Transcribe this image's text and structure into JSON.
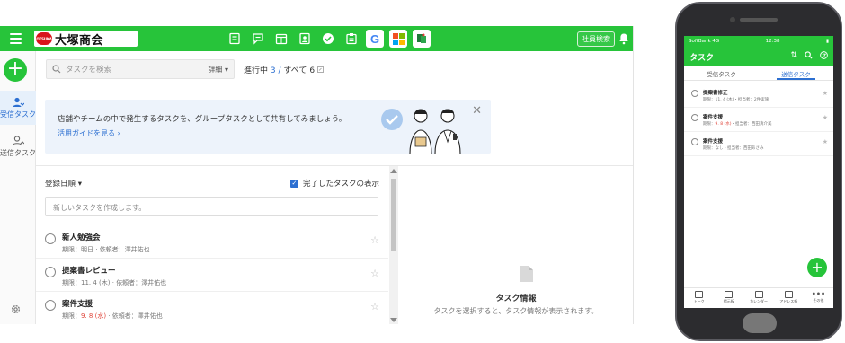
{
  "desktop": {
    "header": {
      "logo_mark": "OTSUKA",
      "logo_text": "大塚商会",
      "staff_search_label": "社員検索",
      "google_label": "G"
    },
    "rail": {
      "new_label": "+",
      "received_label": "受信タスク",
      "sent_label": "送信タスク"
    },
    "search": {
      "placeholder": "タスクを検索",
      "detail_label": "詳細 ▾"
    },
    "counts": {
      "in_progress_label": "進行中",
      "in_progress_value": "3",
      "separator": "/",
      "all_label": "すべて",
      "all_value": "6"
    },
    "banner": {
      "text": "店舗やチームの中で発生するタスクを、グループタスクとして共有してみましょう。",
      "link": "活用ガイドを見る ›"
    },
    "list": {
      "sort_label": "登録日順 ▾",
      "show_completed_label": "完了したタスクの表示",
      "new_task_placeholder": "新しいタスクを作成します。",
      "tasks": [
        {
          "title": "新人勉強会",
          "due_label": "期限：",
          "due": "明日",
          "requester_label": "依頼者：",
          "requester": "澤井佑也",
          "due_red": false
        },
        {
          "title": "提案書レビュー",
          "due_label": "期限：",
          "due": "11. 4 (木)",
          "requester_label": "依頼者：",
          "requester": "澤井佑也",
          "due_red": false
        },
        {
          "title": "案件支援",
          "due_label": "期限：",
          "due": "9. 8 (水)",
          "requester_label": "依頼者：",
          "requester": "澤井佑也",
          "due_red": true
        }
      ]
    },
    "detail": {
      "title": "タスク情報",
      "subtitle": "タスクを選択すると、タスク情報が表示されます。"
    }
  },
  "phone": {
    "status": {
      "carrier": "SoftBank 4G",
      "time": "12:38",
      "battery": "▮"
    },
    "header": {
      "title": "タスク"
    },
    "tabs": [
      {
        "label": "受信タスク",
        "active": false
      },
      {
        "label": "送信タスク",
        "active": true
      }
    ],
    "tasks": [
      {
        "title": "提案書修正",
        "meta_prefix": "期限：",
        "due": "11. 4 (木)",
        "meta_suffix": "・担当者：2件実施",
        "due_red": false
      },
      {
        "title": "案件支援",
        "meta_prefix": "期限：",
        "due": "9. 8 (水)",
        "meta_suffix": "・担当者：西田真介美",
        "due_red": true
      },
      {
        "title": "案件支援",
        "meta_prefix": "期限：",
        "due": "なし",
        "meta_suffix": "・担当者：西田あさみ",
        "due_red": false
      }
    ],
    "bottom_nav": [
      {
        "label": "トーク"
      },
      {
        "label": "掲示板"
      },
      {
        "label": "カレンダー"
      },
      {
        "label": "アドレス帳"
      },
      {
        "label": "その他"
      }
    ]
  },
  "colors": {
    "brand_green": "#27c43a",
    "link_blue": "#2c6fd1",
    "due_red": "#e0453a",
    "banner_bg": "#edf3fb"
  },
  "icons": [
    "menu-icon",
    "notice-icon",
    "chat-icon",
    "calendar-icon",
    "address-icon",
    "task-check-icon",
    "workflow-icon",
    "google-icon",
    "microsoft-icon",
    "external-app-icon",
    "bell-icon",
    "search-icon",
    "star-icon",
    "gear-icon",
    "document-icon"
  ]
}
